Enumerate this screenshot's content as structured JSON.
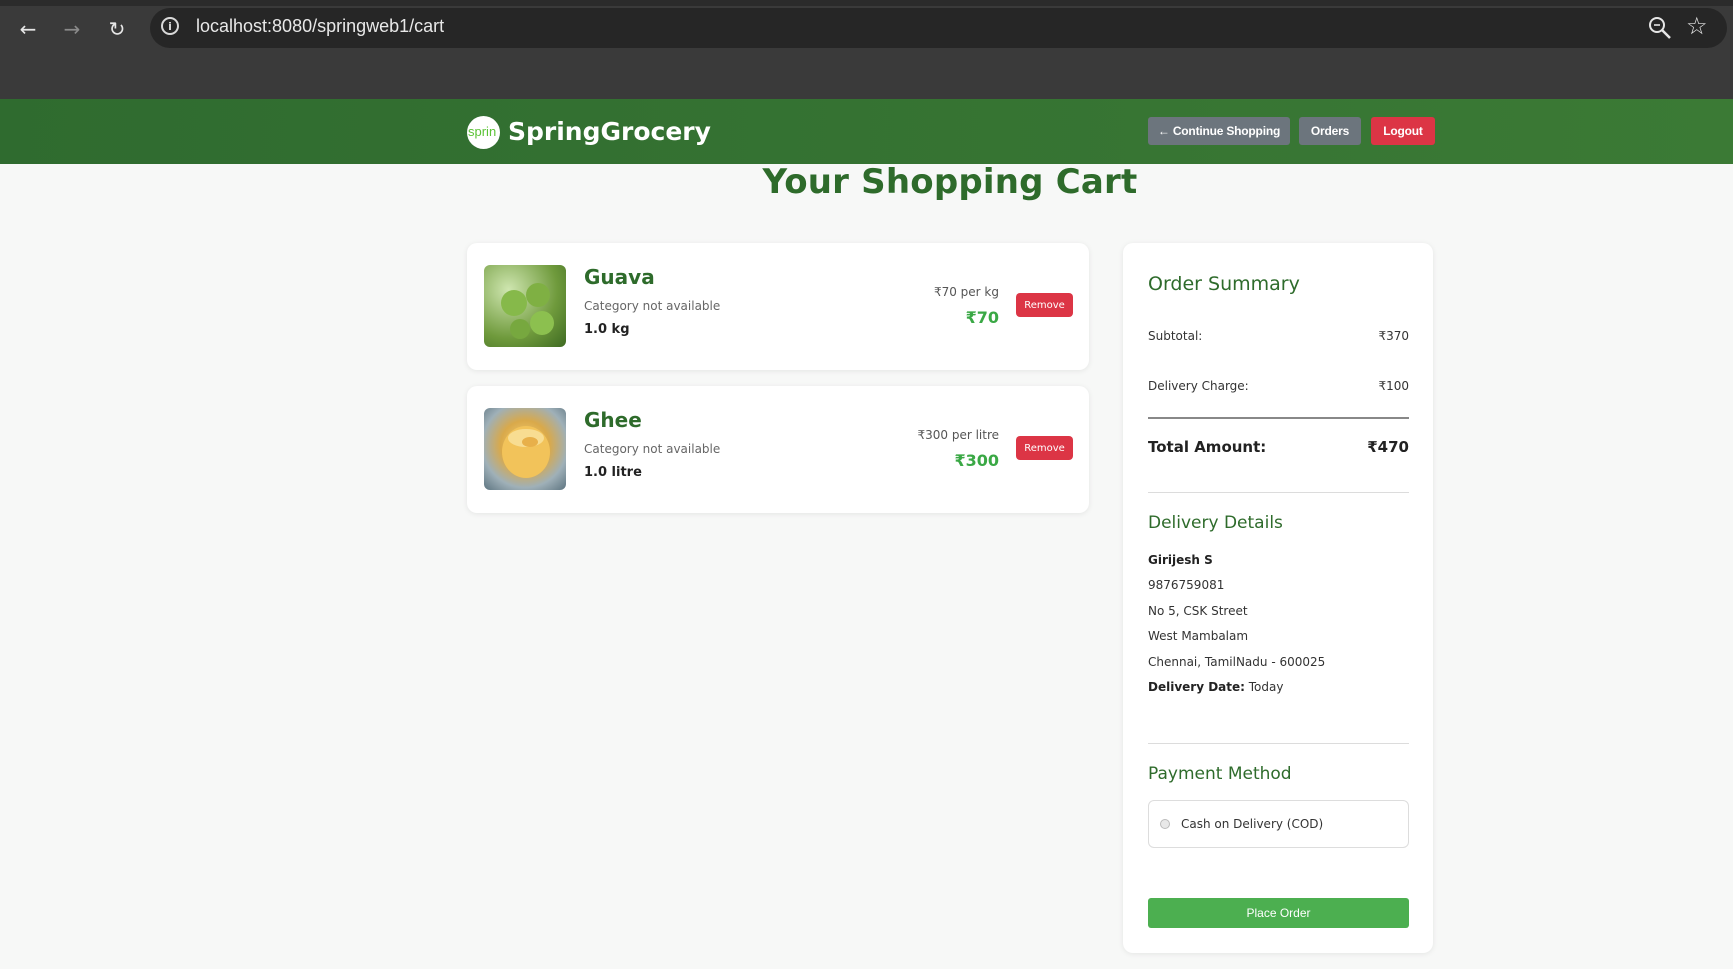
{
  "browser": {
    "url": "localhost:8080/springweb1/cart"
  },
  "header": {
    "logo_text": "sprin",
    "brand": "SpringGrocery",
    "continue_label": "← Continue Shopping",
    "orders_label": "Orders",
    "logout_label": "Logout"
  },
  "page": {
    "title": "Your Shopping Cart"
  },
  "cart": {
    "items": [
      {
        "name": "Guava",
        "category": "Category not available",
        "quantity": "1.0 kg",
        "unit_price": "₹70 per kg",
        "total": "₹70",
        "remove_label": "Remove"
      },
      {
        "name": "Ghee",
        "category": "Category not available",
        "quantity": "1.0 litre",
        "unit_price": "₹300 per litre",
        "total": "₹300",
        "remove_label": "Remove"
      }
    ]
  },
  "summary": {
    "title": "Order Summary",
    "subtotal_label": "Subtotal:",
    "subtotal_value": "₹370",
    "delivery_label": "Delivery Charge:",
    "delivery_value": "₹100",
    "total_label": "Total Amount:",
    "total_value": "₹470"
  },
  "delivery": {
    "title": "Delivery Details",
    "name": "Girijesh S",
    "phone": "9876759081",
    "address_line1": "No 5, CSK Street",
    "address_line2": "West Mambalam",
    "address_line3": "Chennai, TamilNadu - 600025",
    "date_label": "Delivery Date:",
    "date_value": "Today"
  },
  "payment": {
    "title": "Payment Method",
    "option_label": "Cash on Delivery (COD)",
    "place_order_label": "Place Order"
  },
  "colors": {
    "header_green": "#2f6b2f",
    "accent_green": "#3aa845",
    "danger_red": "#dc3545",
    "secondary_gray": "#6c757d"
  }
}
